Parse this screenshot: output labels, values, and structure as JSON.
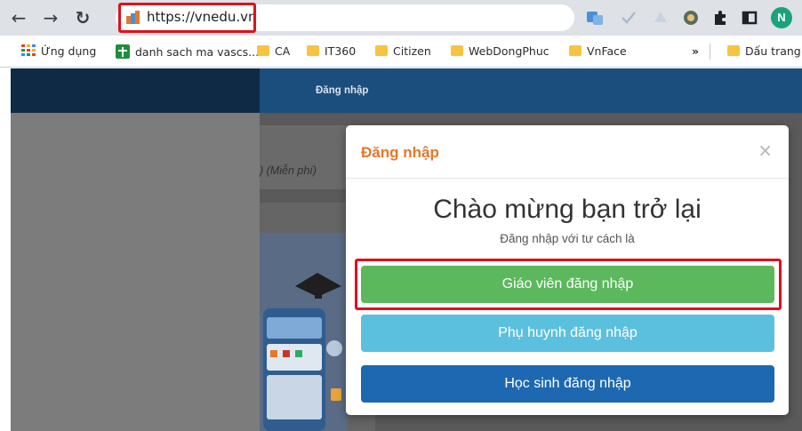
{
  "browser": {
    "url": "https://vnedu.vn",
    "bookmarks": [
      {
        "label": "Ứng dụng"
      },
      {
        "label": "danh sach ma vascs..."
      },
      {
        "label": "CA"
      },
      {
        "label": "IT360"
      },
      {
        "label": "Citizen"
      },
      {
        "label": "WebDongPhuc"
      },
      {
        "label": "VnFace"
      },
      {
        "label": "»"
      },
      {
        "label": "Dấu trang"
      }
    ],
    "profile_initial": "N",
    "highlight_color": "#e0101a"
  },
  "page": {
    "header_label": "Đăng nhập",
    "free_label": ") (Miễn phí)"
  },
  "modal": {
    "title": "Đăng nhập",
    "close": "×",
    "welcome": "Chào mừng bạn trở lại",
    "subtitle": "Đăng nhập với tư cách là",
    "buttons": {
      "teacher": "Giáo viên đăng nhập",
      "parent": "Phụ huynh đăng nhập",
      "student": "Học sinh đăng nhập"
    },
    "colors": {
      "title": "#e8762b",
      "teacher": "#5cb85c",
      "parent": "#5bc0de",
      "student": "#1d68b1"
    }
  }
}
